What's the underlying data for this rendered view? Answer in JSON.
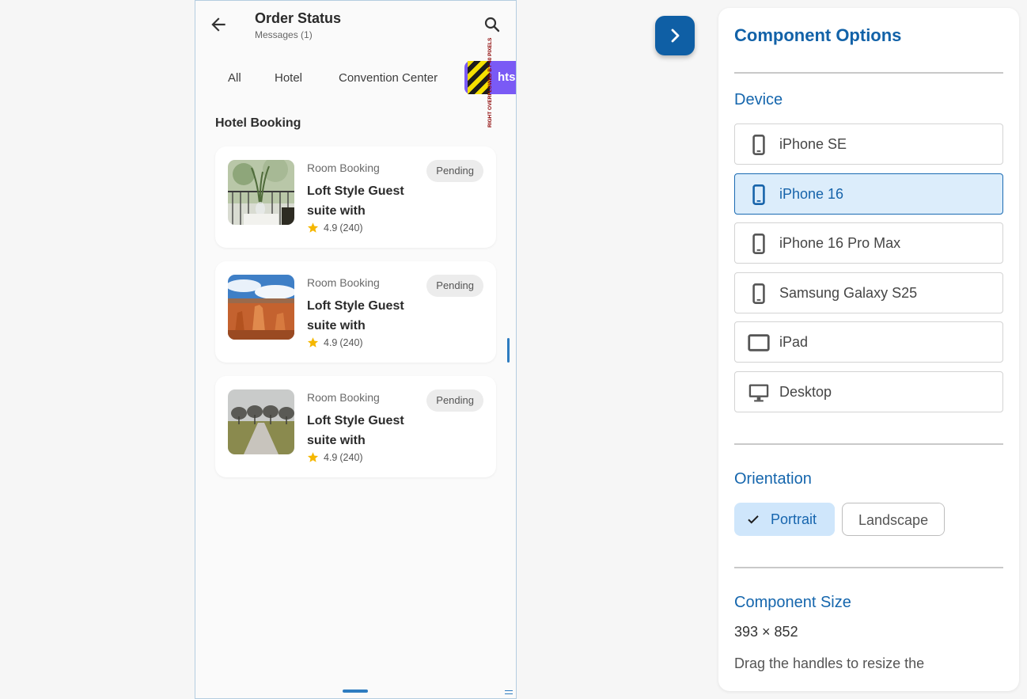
{
  "app": {
    "title": "Order Status",
    "subtitle": "Messages (1)"
  },
  "tabs": [
    "All",
    "Hotel",
    "Convention Center"
  ],
  "overflow_tab_visible_text": "hts",
  "overflow_warning": "RIGHT OVERFLOWED BY 40 PIXELS",
  "section_title": "Hotel Booking",
  "bookings": [
    {
      "type": "Room Booking",
      "name": "Loft Style Guest suite with",
      "rating": "4.9",
      "reviews": "(240)",
      "status": "Pending",
      "image": "balcony-plant-photo"
    },
    {
      "type": "Room Booking",
      "name": "Loft Style Guest suite with",
      "rating": "4.9",
      "reviews": "(240)",
      "status": "Pending",
      "image": "canyon-hoodoos-photo"
    },
    {
      "type": "Room Booking",
      "name": "Loft Style Guest suite with",
      "rating": "4.9",
      "reviews": "(240)",
      "status": "Pending",
      "image": "tree-lined-path-photo"
    }
  ],
  "panel": {
    "title": "Component Options",
    "device_label": "Device",
    "devices": [
      {
        "label": "iPhone SE",
        "icon": "phone-icon",
        "selected": false
      },
      {
        "label": "iPhone 16",
        "icon": "phone-icon",
        "selected": true
      },
      {
        "label": "iPhone 16 Pro Max",
        "icon": "phone-icon",
        "selected": false
      },
      {
        "label": "Samsung Galaxy S25",
        "icon": "phone-icon",
        "selected": false
      },
      {
        "label": "iPad",
        "icon": "tablet-icon",
        "selected": false
      },
      {
        "label": "Desktop",
        "icon": "monitor-icon",
        "selected": false
      }
    ],
    "orientation_label": "Orientation",
    "orientation_options": [
      "Portrait",
      "Landscape"
    ],
    "orientation_selected": "Portrait",
    "size_label": "Component Size",
    "size_value": "393 × 852",
    "size_hint": "Drag the handles to resize the"
  },
  "colors": {
    "accent": "#1262a8",
    "selected_bg": "#dcedfb",
    "tab_overflow_purple": "#7a5af5",
    "star": "#f5b700"
  }
}
